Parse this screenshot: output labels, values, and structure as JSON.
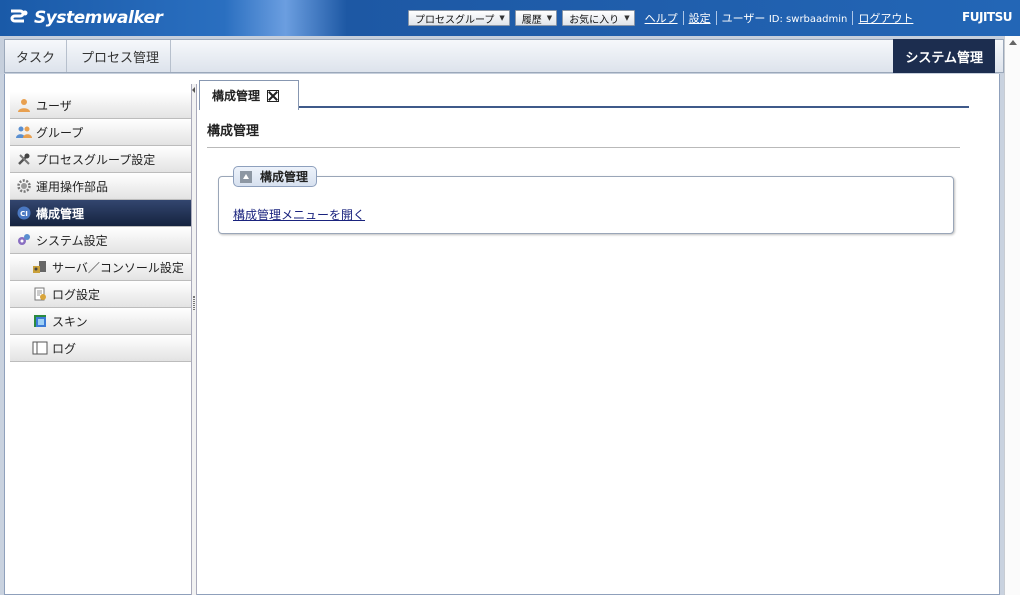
{
  "app": {
    "brand": "Systemwalker",
    "vendor": "FUJITSU"
  },
  "topnav": {
    "dropdowns": [
      "プロセスグループ",
      "履歴",
      "お気に入り"
    ],
    "help": "ヘルプ",
    "settings": "設定",
    "user_label": "ユーザー",
    "user_id": "ID: swrbaadmin",
    "logout": "ログアウト"
  },
  "main_tabs": {
    "task": "タスク",
    "process": "プロセス管理",
    "system": "システム管理"
  },
  "sidebar": {
    "items": [
      {
        "label": "ユーザ",
        "icon": "user-icon"
      },
      {
        "label": "グループ",
        "icon": "group-icon"
      },
      {
        "label": "プロセスグループ設定",
        "icon": "tools-icon"
      },
      {
        "label": "運用操作部品",
        "icon": "gear-icon"
      },
      {
        "label": "構成管理",
        "icon": "ci-icon"
      },
      {
        "label": "システム設定",
        "icon": "settings-gears-icon"
      },
      {
        "label": "サーバ／コンソール設定",
        "icon": "server-console-icon"
      },
      {
        "label": "ログ設定",
        "icon": "log-settings-icon"
      },
      {
        "label": "スキン",
        "icon": "skin-icon"
      },
      {
        "label": "ログ",
        "icon": "log-book-icon"
      }
    ],
    "active_index": 4
  },
  "content": {
    "tab_label": "構成管理",
    "page_title": "構成管理",
    "panel_title": "構成管理",
    "panel_link": "構成管理メニューを開く"
  },
  "colors": {
    "accent": "#1c2d4f",
    "topbar": "#2366b6",
    "link": "#1a237e"
  }
}
